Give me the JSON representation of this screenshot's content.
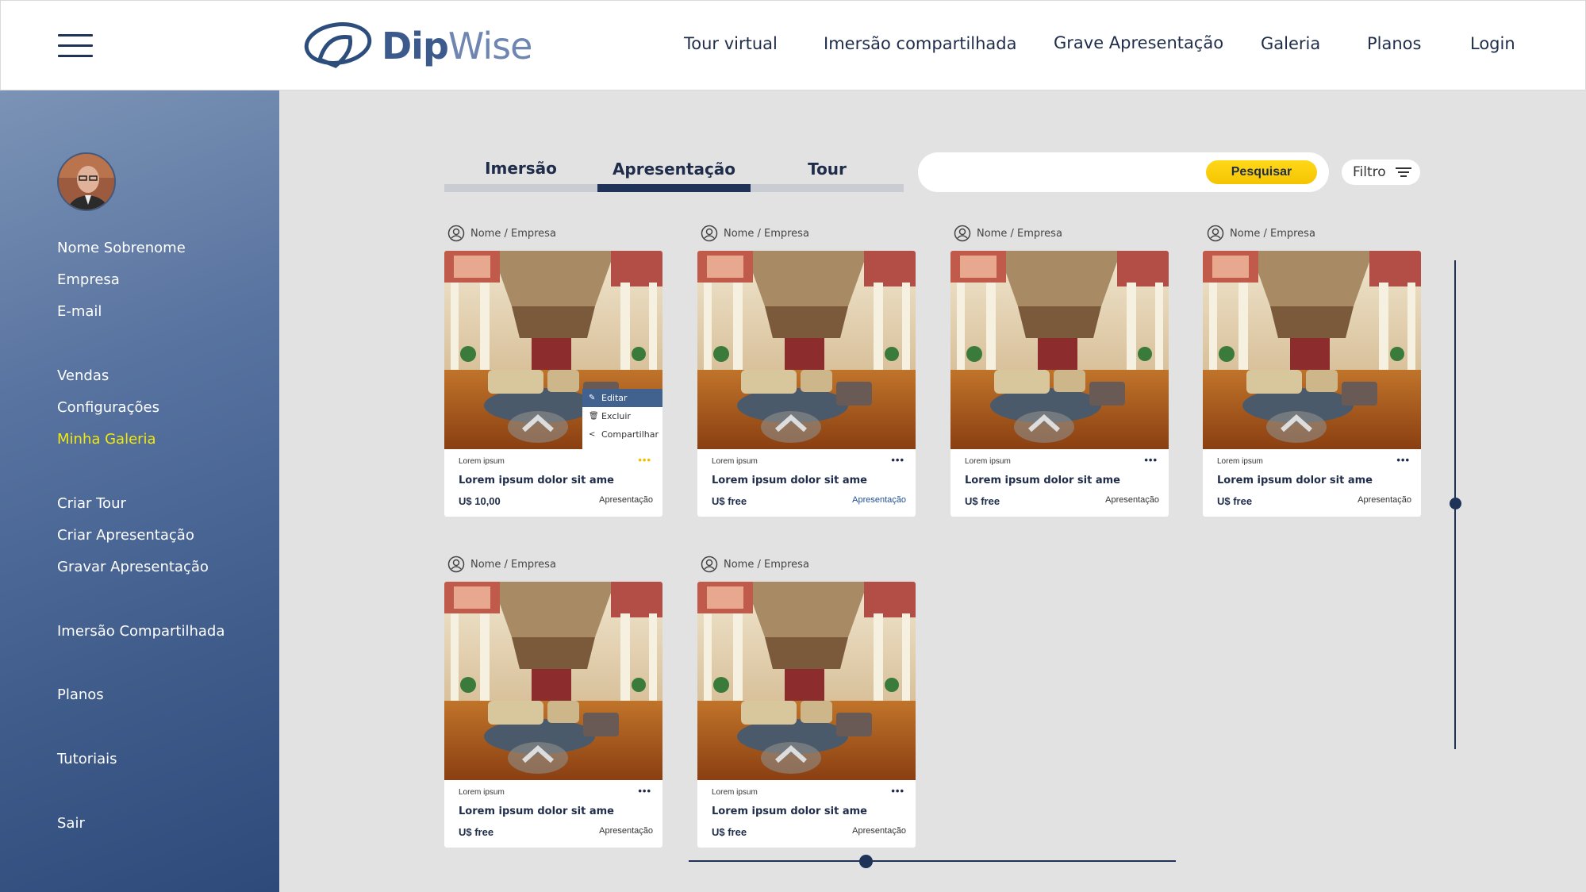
{
  "header": {
    "logo_part1": "Dip",
    "logo_part2": "Wise",
    "nav": [
      "Tour virtual",
      "Imersão compartilhada",
      "Grave Apresentação",
      "Galeria",
      "Planos",
      "Login"
    ]
  },
  "sidebar": {
    "profile": [
      "Nome Sobrenome",
      "Empresa",
      "E-mail"
    ],
    "items": [
      "Vendas",
      "Configurações",
      "Minha Galeria",
      "Criar Tour",
      "Criar Apresentação",
      "Gravar Apresentação",
      "Imersão Compartilhada",
      "Planos",
      "Tutoriais",
      "Sair"
    ],
    "active": "Minha Galeria"
  },
  "tabs": [
    "Imersão",
    "Apresentação",
    "Tour"
  ],
  "active_tab": "Apresentação",
  "search": {
    "placeholder": "",
    "button": "Pesquisar"
  },
  "filter": {
    "label": "Filtro"
  },
  "context_menu": [
    "Editar",
    "Excluir",
    "Compartilhar"
  ],
  "cards": [
    {
      "owner": "Nome / Empresa",
      "category": "Lorem ipsum",
      "title": "Lorem ipsum dolor sit ame",
      "price": "U$ 10,00",
      "type": "Apresentação"
    },
    {
      "owner": "Nome / Empresa",
      "category": "Lorem ipsum",
      "title": "Lorem ipsum dolor sit ame",
      "price": "U$ free",
      "type": "Apresentação"
    },
    {
      "owner": "Nome / Empresa",
      "category": "Lorem ipsum",
      "title": "Lorem ipsum dolor sit ame",
      "price": "U$ free",
      "type": "Apresentação"
    },
    {
      "owner": "Nome / Empresa",
      "category": "Lorem ipsum",
      "title": "Lorem ipsum dolor sit ame",
      "price": "U$ free",
      "type": "Apresentação"
    },
    {
      "owner": "Nome / Empresa",
      "category": "Lorem ipsum",
      "title": "Lorem ipsum dolor sit ame",
      "price": "U$ free",
      "type": "Apresentação"
    },
    {
      "owner": "Nome / Empresa",
      "category": "Lorem ipsum",
      "title": "Lorem ipsum dolor sit ame",
      "price": "U$ free",
      "type": "Apresentação"
    }
  ],
  "colors": {
    "primary": "#1f3358",
    "accent": "#f5c400",
    "active_sidebar": "#f2e90c"
  }
}
